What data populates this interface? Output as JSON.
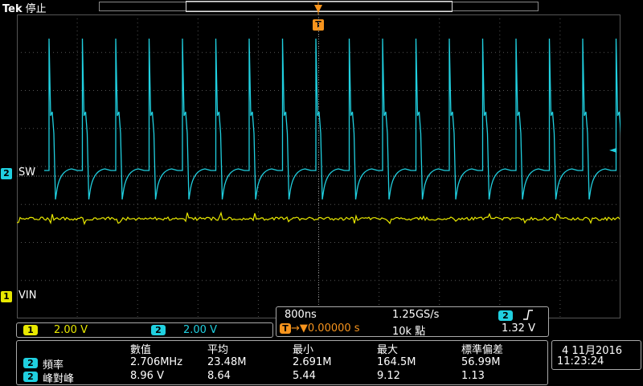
{
  "header": {
    "brand": "Tek",
    "status": "停止"
  },
  "trigger": {
    "marker": "T"
  },
  "channels": [
    {
      "id": "1",
      "name": "VIN",
      "color": "#e8e800",
      "scale": "2.00 V"
    },
    {
      "id": "2",
      "name": "SW",
      "color": "#20d0e0",
      "scale": "2.00 V"
    }
  ],
  "timebase": {
    "horizontal": "800ns",
    "sample_rate": "1.25GS/s",
    "trigger_channel": "2",
    "trigger_slope_icon": "rising-edge-icon",
    "trigger_prefix": "T",
    "delay": "→▼0.00000 s",
    "record_length": "10k 點",
    "trigger_level": "1.32 V"
  },
  "measurements": {
    "headers": [
      "數值",
      "平均",
      "最小",
      "最大",
      "標準偏差"
    ],
    "rows": [
      {
        "channel": "2",
        "label": "頻率",
        "values": [
          "2.706MHz",
          "23.48M",
          "2.691M",
          "164.5M",
          "56.99M"
        ]
      },
      {
        "channel": "2",
        "label": "峰對峰",
        "values": [
          "8.96 V",
          "8.64",
          "5.44",
          "9.12",
          "1.13"
        ]
      }
    ]
  },
  "datetime": {
    "date": "4 11月2016",
    "time": "11:23:24"
  },
  "colors": {
    "ch1": "#e8e800",
    "ch2": "#20d0e0",
    "trigger": "#f7941d",
    "grid": "#555555"
  }
}
